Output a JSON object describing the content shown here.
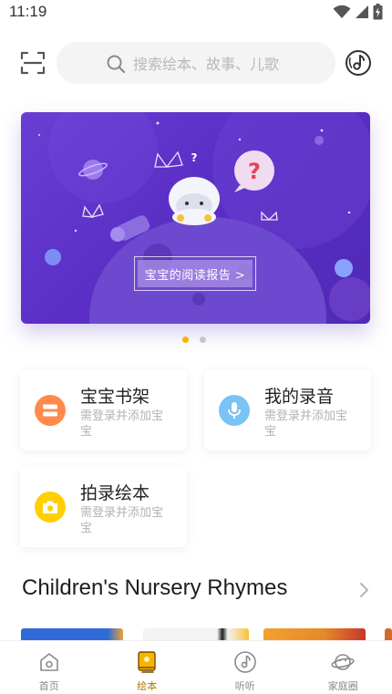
{
  "status_bar": {
    "time": "11:19"
  },
  "search": {
    "placeholder": "搜索绘本、故事、儿歌"
  },
  "banner": {
    "cta_label": "宝宝的阅读报告 >",
    "total_pages": 2,
    "active_page": 1
  },
  "cards": [
    {
      "title": "宝宝书架",
      "subtitle": "需登录并添加宝宝",
      "icon": "bookshelf-icon",
      "color": "#ff8a4c"
    },
    {
      "title": "我的录音",
      "subtitle": "需登录并添加宝宝",
      "icon": "microphone-icon",
      "color": "#79c3f7"
    },
    {
      "title": "拍录绘本",
      "subtitle": "需登录并添加宝宝",
      "icon": "camera-icon",
      "color": "#ffd000"
    }
  ],
  "section": {
    "title": "Children's Nursery Rhymes"
  },
  "bottom_nav": [
    {
      "label": "首页",
      "icon": "home-icon",
      "active": false
    },
    {
      "label": "绘本",
      "icon": "picture-book-icon",
      "active": true
    },
    {
      "label": "听听",
      "icon": "music-note-icon",
      "active": false
    },
    {
      "label": "家庭圈",
      "icon": "planet-icon",
      "active": false
    }
  ],
  "colors": {
    "accent": "#f6b400",
    "active_nav_text": "#b07a00",
    "banner_purple": "#5b2fc6"
  }
}
